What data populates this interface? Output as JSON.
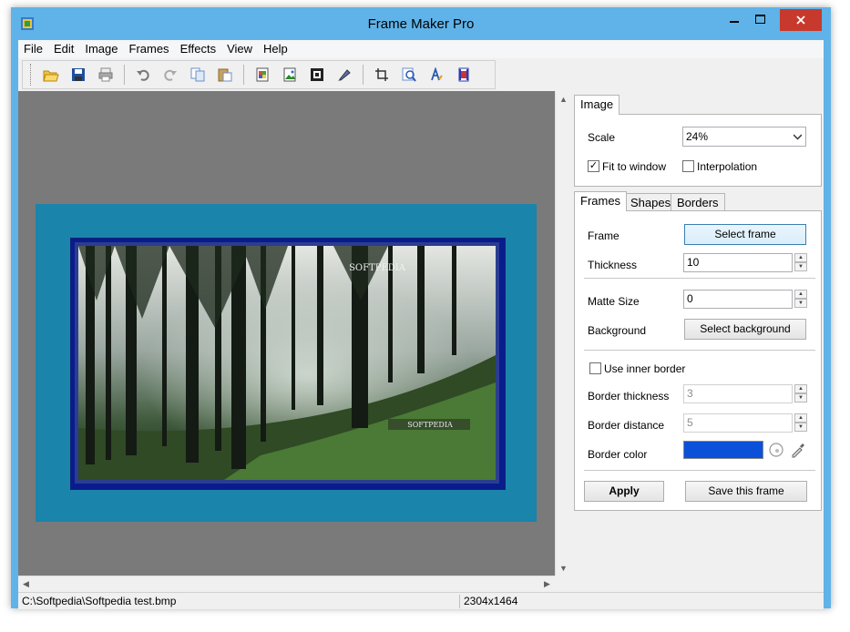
{
  "window": {
    "title": "Frame Maker Pro"
  },
  "menu": [
    "File",
    "Edit",
    "Image",
    "Frames",
    "Effects",
    "View",
    "Help"
  ],
  "toolbar": {
    "buttons": [
      "open-icon",
      "save-icon",
      "print-icon",
      "undo-icon",
      "redo-icon",
      "copy-icon",
      "paste-icon",
      "image-icon",
      "picture-icon",
      "frame-icon",
      "brush-icon",
      "crop-icon",
      "zoom-icon",
      "text-icon",
      "film-icon"
    ]
  },
  "status": {
    "path": "C:\\Softpedia\\Softpedia test.bmp",
    "size": "2304x1464"
  },
  "photo": {
    "watermark_top": "SOFTPEDIA",
    "watermark_bottom": "SOFTPEDIA"
  },
  "image_tab": {
    "label": "Image",
    "scale_label": "Scale",
    "scale_value": "24%",
    "fit_label": "Fit to window",
    "fit_checked": true,
    "interp_label": "Interpolation",
    "interp_checked": false
  },
  "frames_tabs": [
    "Frames",
    "Shapes",
    "Borders"
  ],
  "frames_tab": {
    "frame_label": "Frame",
    "select_frame": "Select frame",
    "thickness_label": "Thickness",
    "thickness_value": "10",
    "matte_label": "Matte Size",
    "matte_value": "0",
    "background_label": "Background",
    "select_background": "Select background",
    "inner_border_label": "Use inner border",
    "border_thickness_label": "Border thickness",
    "border_thickness_value": "3",
    "border_distance_label": "Border distance",
    "border_distance_value": "5",
    "border_color_label": "Border color",
    "border_color": "#0a50d8",
    "apply": "Apply",
    "save_frame": "Save this frame"
  },
  "colors": {
    "matte": "#1b84aa",
    "frame": "#0a1b8c",
    "canvas": "#7a7a7a",
    "close": "#c7392c"
  }
}
